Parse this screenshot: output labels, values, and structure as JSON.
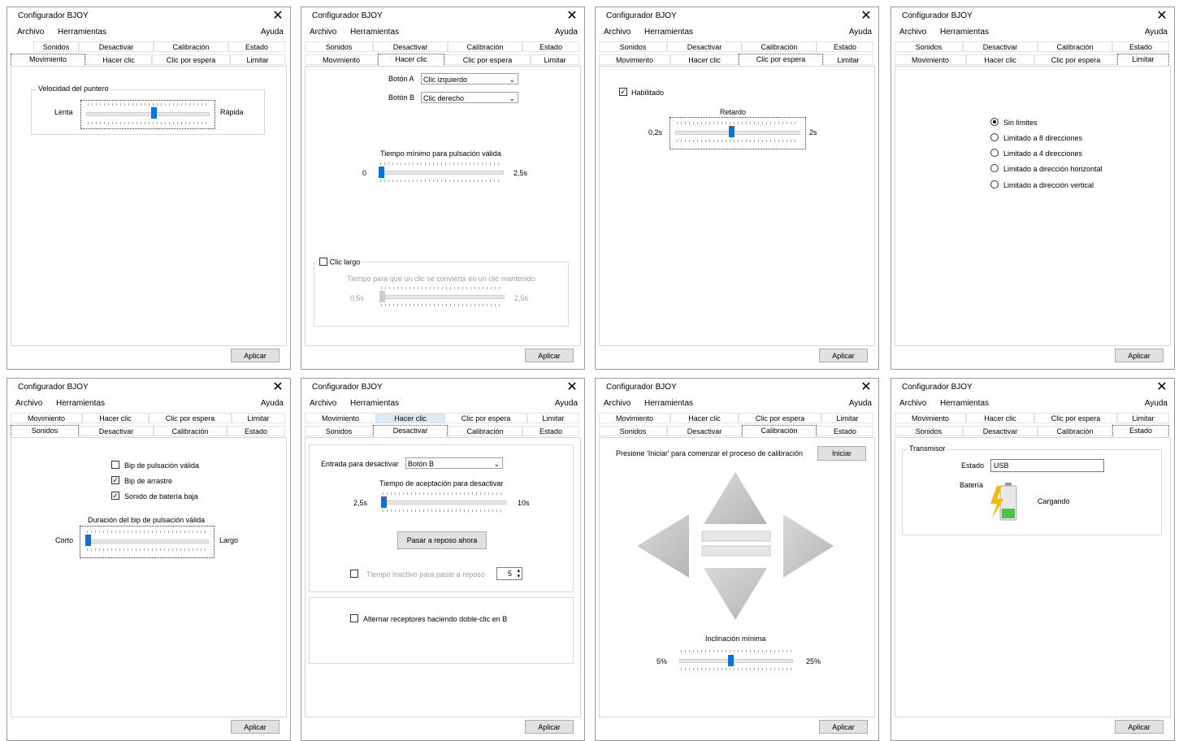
{
  "window": {
    "title": "Configurador BJOY",
    "close": "✕",
    "menu": {
      "file": "Archivo",
      "tools": "Herramientas",
      "help": "Ayuda"
    },
    "apply": "Aplicar"
  },
  "tabs": {
    "sounds": "Sonidos",
    "disable": "Desactivar",
    "calibration": "Calibración",
    "status": "Estado",
    "movement": "Movimiento",
    "click": "Hacer clic",
    "dwell": "Clic por espera",
    "limit": "Limitar"
  },
  "movement": {
    "group": "Velocidad del puntero",
    "slow": "Lenta",
    "fast": "Rápida",
    "speed_fraction": 0.55
  },
  "click": {
    "button_a_label": "Botón A",
    "button_a_value": "Clic izquierdo",
    "button_b_label": "Botón B",
    "button_b_value": "Clic derecho",
    "min_press_label": "Tiempo mínimo para pulsación válida",
    "min_press_min": "0",
    "min_press_max": "2,5s",
    "min_press_fraction": 0.0,
    "long_click_label": "Clic largo",
    "long_click_desc": "Tiempo para que un clic se convierta en un clic mantenido",
    "long_min": "0,5s",
    "long_max": "2,5s",
    "long_fraction": 0.0
  },
  "dwell": {
    "enabled_label": "Habilitado",
    "delay_label": "Retardo",
    "delay_min": "0,2s",
    "delay_max": "2s",
    "delay_fraction": 0.45
  },
  "limit": {
    "options": [
      "Sin límites",
      "Limitado a 8 direcciones",
      "Limitado a 4 direcciones",
      "Limitado a dirección horizontal",
      "Limitado a dirección vertical"
    ],
    "selected": 0
  },
  "sounds": {
    "valid_beep": "Bip de pulsación válida",
    "drag_beep": "Bip de arrastre",
    "low_battery": "Sonido de batería baja",
    "duration_label": "Duración del bip de pulsación válida",
    "short": "Corto",
    "long": "Largo",
    "duration_fraction": 0.0
  },
  "disable": {
    "input_label": "Entrada para desactivar",
    "input_value": "Botón B",
    "accept_label": "Tiempo de aceptación para desactivar",
    "accept_min": "2,5s",
    "accept_max": "10s",
    "accept_fraction": 0.0,
    "sleep_button": "Pasar a reposo ahora",
    "idle_label": "Tiempo inactivo para pasar a reposo",
    "idle_value": "5",
    "toggle_label": "Alternar receptores haciendo doble-clic en B"
  },
  "calibration": {
    "instruction": "Presione 'Iniciar' para comenzar el proceso de calibración",
    "start": "Iniciar",
    "tilt_label": "Inclinación mínima",
    "tilt_min": "5%",
    "tilt_max": "25%",
    "tilt_fraction": 0.45
  },
  "status": {
    "group": "Transmisor",
    "state_label": "Estado",
    "state_value": "USB",
    "battery_label": "Batería",
    "battery_status": "Cargando"
  }
}
